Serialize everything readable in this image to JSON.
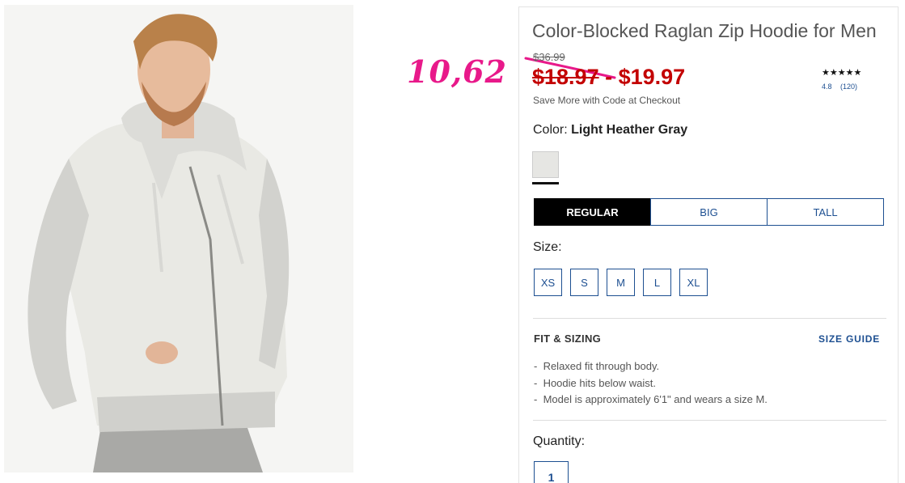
{
  "annotation": {
    "handwritten_price": "10,62"
  },
  "product": {
    "title": "Color-Blocked Raglan Zip Hoodie for Men",
    "old_price": "$36.99",
    "price_low": "$18.97",
    "price_separator": " - ",
    "price_high": "$19.97",
    "promo": "Save More with Code at Checkout",
    "rating": {
      "stars": "★★★★★",
      "value": "4.8",
      "count": "(120)"
    },
    "color_label": "Color: ",
    "color_value": "Light Heather Gray",
    "fit_tabs": [
      "REGULAR",
      "BIG",
      "TALL"
    ],
    "size_label": "Size:",
    "sizes": [
      "XS",
      "S",
      "M",
      "L",
      "XL"
    ],
    "fit_heading": "FIT & SIZING",
    "size_guide": "SIZE GUIDE",
    "fit_details": [
      "Relaxed fit through body.",
      "Hoodie hits below waist.",
      "Model is approximately 6'1\" and wears a size M."
    ],
    "quantity_label": "Quantity:",
    "quantity_value": "1"
  },
  "colors": {
    "sale_red": "#c30000",
    "annotation_pink": "#e8198a",
    "link_blue": "#1d4f91"
  }
}
